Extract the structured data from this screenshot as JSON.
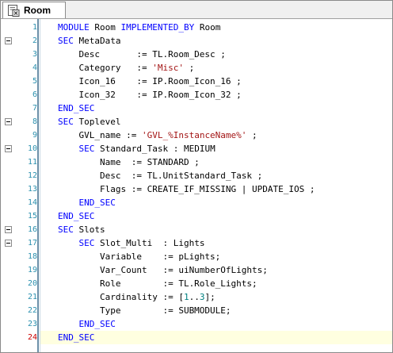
{
  "tab": {
    "title": "Room",
    "icon": "object-file-icon"
  },
  "colors": {
    "keyword": "#0000ff",
    "string": "#a31515",
    "number": "#008080",
    "line_number": "#2b91af",
    "current_line_number": "#cc0000"
  },
  "editor": {
    "current_line": 24,
    "lines": [
      {
        "n": "1",
        "fold": false,
        "parts": [
          [
            "kw",
            "MODULE"
          ],
          [
            "t",
            " Room "
          ],
          [
            "kw",
            "IMPLEMENTED_BY"
          ],
          [
            "t",
            " Room"
          ]
        ]
      },
      {
        "n": "2",
        "fold": true,
        "parts": [
          [
            "kw",
            "SEC"
          ],
          [
            "t",
            " MetaData"
          ]
        ]
      },
      {
        "n": "3",
        "fold": false,
        "parts": [
          [
            "t",
            "    Desc       := TL.Room_Desc ;"
          ]
        ]
      },
      {
        "n": "4",
        "fold": false,
        "parts": [
          [
            "t",
            "    Category   := "
          ],
          [
            "str",
            "'Misc'"
          ],
          [
            "t",
            " ;"
          ]
        ]
      },
      {
        "n": "5",
        "fold": false,
        "parts": [
          [
            "t",
            "    Icon_16    := IP.Room_Icon_16 ;"
          ]
        ]
      },
      {
        "n": "6",
        "fold": false,
        "parts": [
          [
            "t",
            "    Icon_32    := IP.Room_Icon_32 ;"
          ]
        ]
      },
      {
        "n": "7",
        "fold": false,
        "parts": [
          [
            "kw",
            "END_SEC"
          ]
        ]
      },
      {
        "n": "8",
        "fold": true,
        "parts": [
          [
            "kw",
            "SEC"
          ],
          [
            "t",
            " Toplevel"
          ]
        ]
      },
      {
        "n": "9",
        "fold": false,
        "parts": [
          [
            "t",
            "    GVL_name := "
          ],
          [
            "str",
            "'GVL_%InstanceName%'"
          ],
          [
            "t",
            " ;"
          ]
        ]
      },
      {
        "n": "10",
        "fold": true,
        "parts": [
          [
            "t",
            "    "
          ],
          [
            "kw",
            "SEC"
          ],
          [
            "t",
            " Standard_Task : MEDIUM"
          ]
        ]
      },
      {
        "n": "11",
        "fold": false,
        "parts": [
          [
            "t",
            "        Name  := STANDARD ;"
          ]
        ]
      },
      {
        "n": "12",
        "fold": false,
        "parts": [
          [
            "t",
            "        Desc  := TL.UnitStandard_Task ;"
          ]
        ]
      },
      {
        "n": "13",
        "fold": false,
        "parts": [
          [
            "t",
            "        Flags := CREATE_IF_MISSING | UPDATE_IOS ;"
          ]
        ]
      },
      {
        "n": "14",
        "fold": false,
        "parts": [
          [
            "t",
            "    "
          ],
          [
            "kw",
            "END_SEC"
          ]
        ]
      },
      {
        "n": "15",
        "fold": false,
        "parts": [
          [
            "kw",
            "END_SEC"
          ]
        ]
      },
      {
        "n": "16",
        "fold": true,
        "parts": [
          [
            "kw",
            "SEC"
          ],
          [
            "t",
            " Slots"
          ]
        ]
      },
      {
        "n": "17",
        "fold": true,
        "parts": [
          [
            "t",
            "    "
          ],
          [
            "kw",
            "SEC"
          ],
          [
            "t",
            " Slot_Multi  : Lights"
          ]
        ]
      },
      {
        "n": "18",
        "fold": false,
        "parts": [
          [
            "t",
            "        Variable    := pLights;"
          ]
        ]
      },
      {
        "n": "19",
        "fold": false,
        "parts": [
          [
            "t",
            "        Var_Count   := uiNumberOfLights;"
          ]
        ]
      },
      {
        "n": "20",
        "fold": false,
        "parts": [
          [
            "t",
            "        Role        := TL.Role_Lights;"
          ]
        ]
      },
      {
        "n": "21",
        "fold": false,
        "parts": [
          [
            "t",
            "        Cardinality := ["
          ],
          [
            "num",
            "1"
          ],
          [
            "t",
            ".."
          ],
          [
            "num",
            "3"
          ],
          [
            "t",
            "];"
          ]
        ]
      },
      {
        "n": "22",
        "fold": false,
        "parts": [
          [
            "t",
            "        Type        := SUBMODULE;"
          ]
        ]
      },
      {
        "n": "23",
        "fold": false,
        "parts": [
          [
            "t",
            "    "
          ],
          [
            "kw",
            "END_SEC"
          ]
        ]
      },
      {
        "n": "24",
        "fold": false,
        "parts": [
          [
            "kw",
            "END_SEC"
          ]
        ]
      }
    ]
  }
}
